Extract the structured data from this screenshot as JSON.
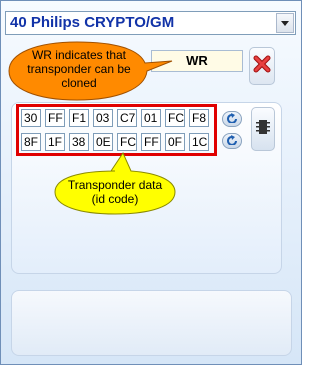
{
  "dropdown": {
    "selected": "40 Philips CRYPTO/GM"
  },
  "wr_field": {
    "value": "WR"
  },
  "callouts": {
    "wr_note_line1": "WR indicates that",
    "wr_note_line2": "transponder can be",
    "wr_note_line3": "cloned",
    "data_note_line1": "Transponder data",
    "data_note_line2": "(id code)"
  },
  "transponder_data": {
    "row1": [
      "30",
      "FF",
      "F1",
      "03",
      "C7",
      "01",
      "FC",
      "F8"
    ],
    "row2": [
      "8F",
      "1F",
      "38",
      "0E",
      "FC",
      "FF",
      "0F",
      "1C"
    ]
  },
  "icons": {
    "dropdown": "chevron-down-icon",
    "clear": "red-x-icon",
    "refresh": "refresh-arrow-icon",
    "chip": "chip-icon"
  },
  "colors": {
    "title_text": "#1233a8",
    "callout_wr_fill": "#ff8a00",
    "callout_data_fill": "#ffff00",
    "highlight_border": "#e00000"
  }
}
